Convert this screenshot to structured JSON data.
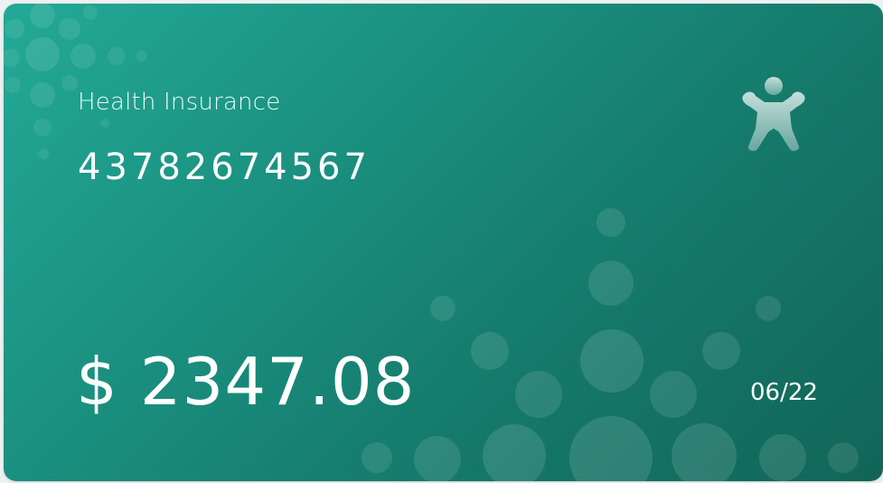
{
  "card": {
    "title": "Health Insurance",
    "number": "43782674567",
    "amount": "$ 2347.08",
    "expiry": "06/22",
    "logo_icon": "person-arms-up-icon",
    "colors": {
      "gradient_start": "#23a996",
      "gradient_end": "#116558",
      "text": "#ffffff"
    }
  }
}
